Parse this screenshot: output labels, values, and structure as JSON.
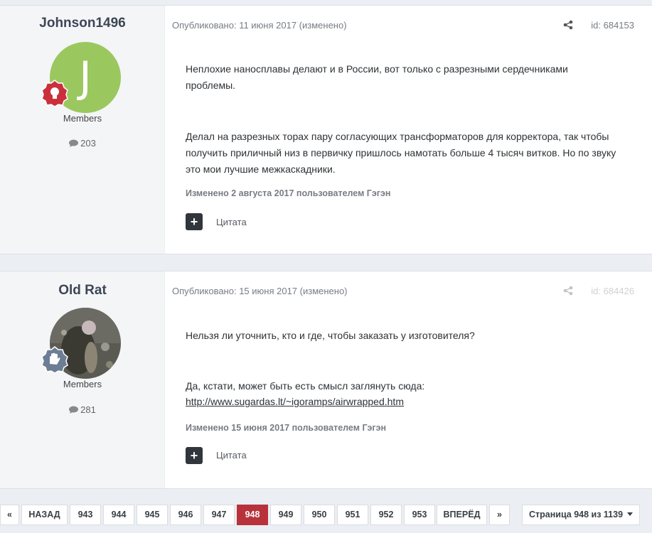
{
  "posts": [
    {
      "author": "Johnson1496",
      "avatar_letter": "J",
      "avatar_color": "#9ac85f",
      "rank_badge": "lightbulb-badge",
      "group": "Members",
      "post_count": "203",
      "meta": "Опубликовано: 11 июня 2017 (изменено)",
      "id": "id: 684153",
      "paragraphs": [
        "Неплохие наносплавы делают и в России, вот только с разрезными сердечниками проблемы.",
        "Делал на разрезных торах пару согласующих трансформаторов для корректора, так чтобы получить приличный низ в первичку пришлось намотать больше 4 тысяч витков. Но по звуку это мои лучшие межкаскадники."
      ],
      "edited": "Изменено 2 августа 2017 пользователем Гэгэн",
      "quote_label": "Цитата"
    },
    {
      "author": "Old Rat",
      "avatar_image": "rat-photo",
      "rank_badge": "waving-hand-badge",
      "group": "Members",
      "post_count": "281",
      "meta": "Опубликовано: 15 июня 2017 (изменено)",
      "id": "id: 684426",
      "paragraphs": [
        "Нельзя ли уточнить, кто и где, чтобы заказать у изготовителя?",
        "Да, кстати, может быть есть смысл заглянуть сюда:"
      ],
      "link": "http://www.sugardas.lt/~igoramps/airwrapped.htm",
      "edited": "Изменено 15 июня 2017 пользователем Гэгэн",
      "quote_label": "Цитата"
    }
  ],
  "pagination": {
    "first": "«",
    "prev": "НАЗАД",
    "pages": [
      "943",
      "944",
      "945",
      "946",
      "947",
      "948",
      "949",
      "950",
      "951",
      "952",
      "953"
    ],
    "current": "948",
    "next": "ВПЕРЁД",
    "last": "»",
    "page_of": "Страница 948 из 1139"
  },
  "colors": {
    "active_page": "#b8323b",
    "author_panel": "#f4f5f7",
    "page_background": "#ebeef2"
  }
}
